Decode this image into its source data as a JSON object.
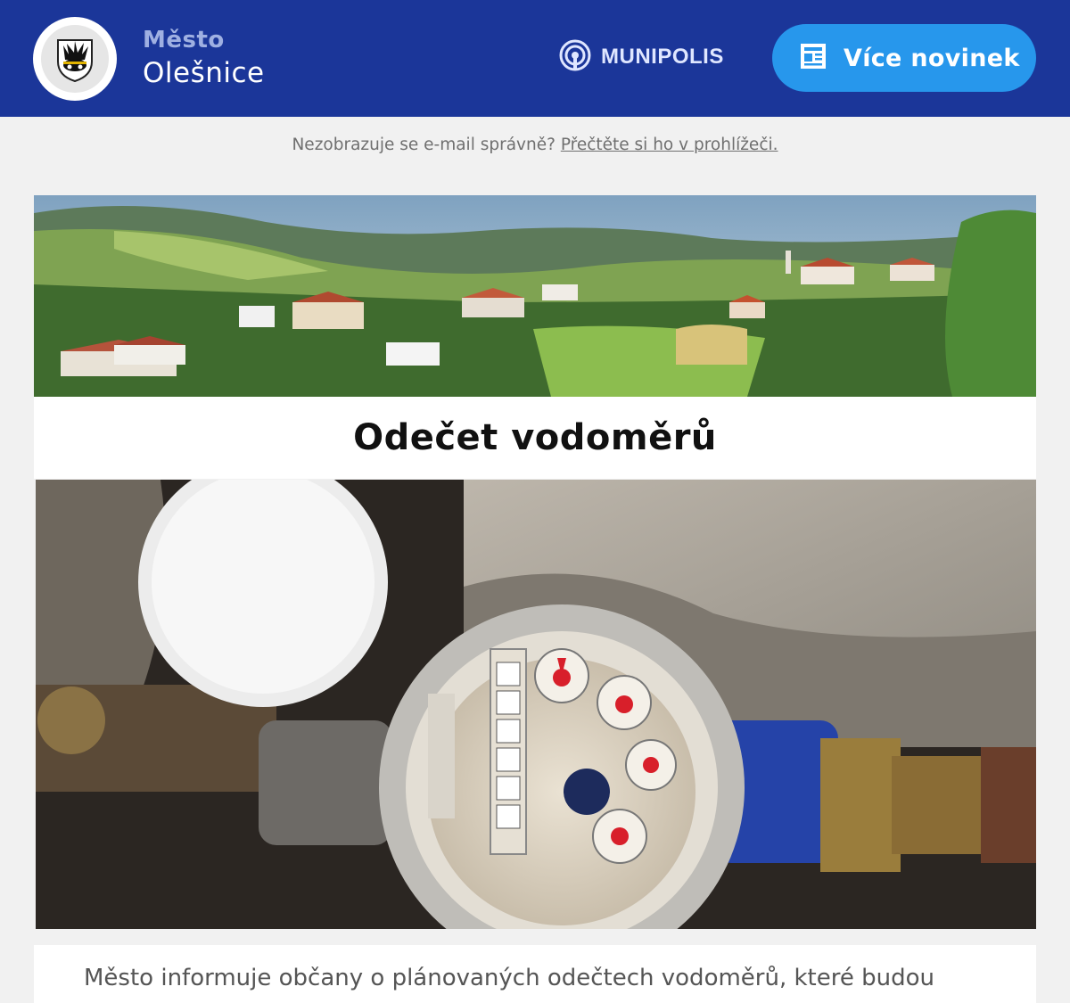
{
  "header": {
    "town_label": "Město",
    "town_name": "Olešnice",
    "platform_name": "MUNIPOLIS",
    "more_news_label": "Více novinek"
  },
  "notice": {
    "text": "Nezobrazuje se e-mail správně?",
    "link_text": "Přečtěte si ho v prohlížeči."
  },
  "article": {
    "title": "Odečet vodoměrů",
    "body": "Město informuje občany o plánovaných odečtech vodoměrů, které budou"
  },
  "colors": {
    "header_bg": "#1b3699",
    "button_bg": "#2797ec",
    "page_bg": "#f1f1f1"
  }
}
